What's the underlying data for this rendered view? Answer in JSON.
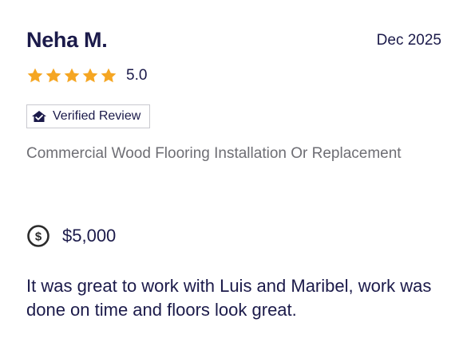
{
  "review": {
    "reviewer_name": "Neha M.",
    "date": "Dec 2025",
    "rating": {
      "value": "5.0",
      "stars_filled": 5,
      "stars_total": 5,
      "star_color": "#f5a623"
    },
    "verified_badge": {
      "label": "Verified Review",
      "icon": "verified-house-icon"
    },
    "service": "Commercial Wood Flooring Installation Or Replacement",
    "cost": {
      "icon": "dollar-circle-icon",
      "value": "$5,000"
    },
    "text": "It was great to work with Luis and Maribel, work was done on time and floors look great."
  },
  "colors": {
    "text_primary": "#1b1a4a",
    "text_secondary": "#6e6e74",
    "badge_border": "#c9c9cf"
  }
}
